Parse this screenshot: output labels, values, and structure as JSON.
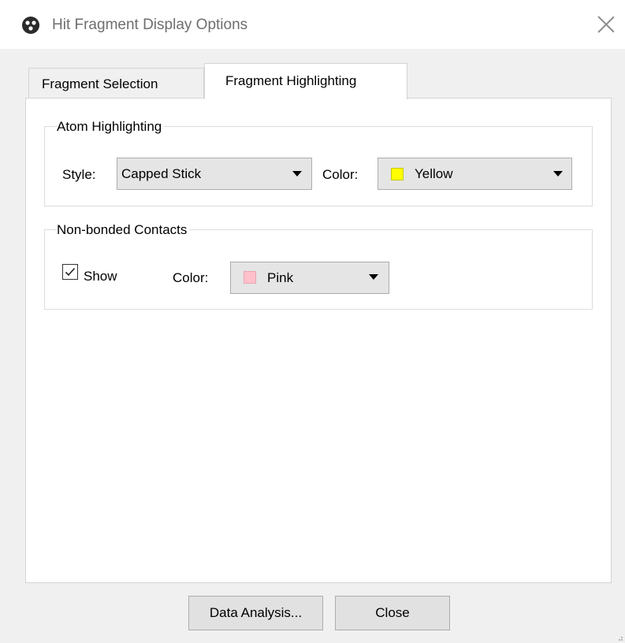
{
  "window": {
    "title": "Hit Fragment Display Options",
    "app_icon": "app-logo-icon",
    "close_icon": "close-icon"
  },
  "tabs": [
    {
      "label": "Fragment Selection",
      "active": false
    },
    {
      "label": "Fragment Highlighting",
      "active": true
    }
  ],
  "atom_highlighting": {
    "title": "Atom Highlighting",
    "style_label": "Style:",
    "style_value": "Capped Stick",
    "color_label": "Color:",
    "color_value": "Yellow",
    "color_swatch": "#ffff00"
  },
  "nonbonded_contacts": {
    "title": "Non-bonded Contacts",
    "show_label": "Show",
    "show_checked": true,
    "color_label": "Color:",
    "color_value": "Pink",
    "color_swatch": "#ffc0cb"
  },
  "buttons": {
    "data_analysis": "Data Analysis...",
    "close": "Close"
  }
}
